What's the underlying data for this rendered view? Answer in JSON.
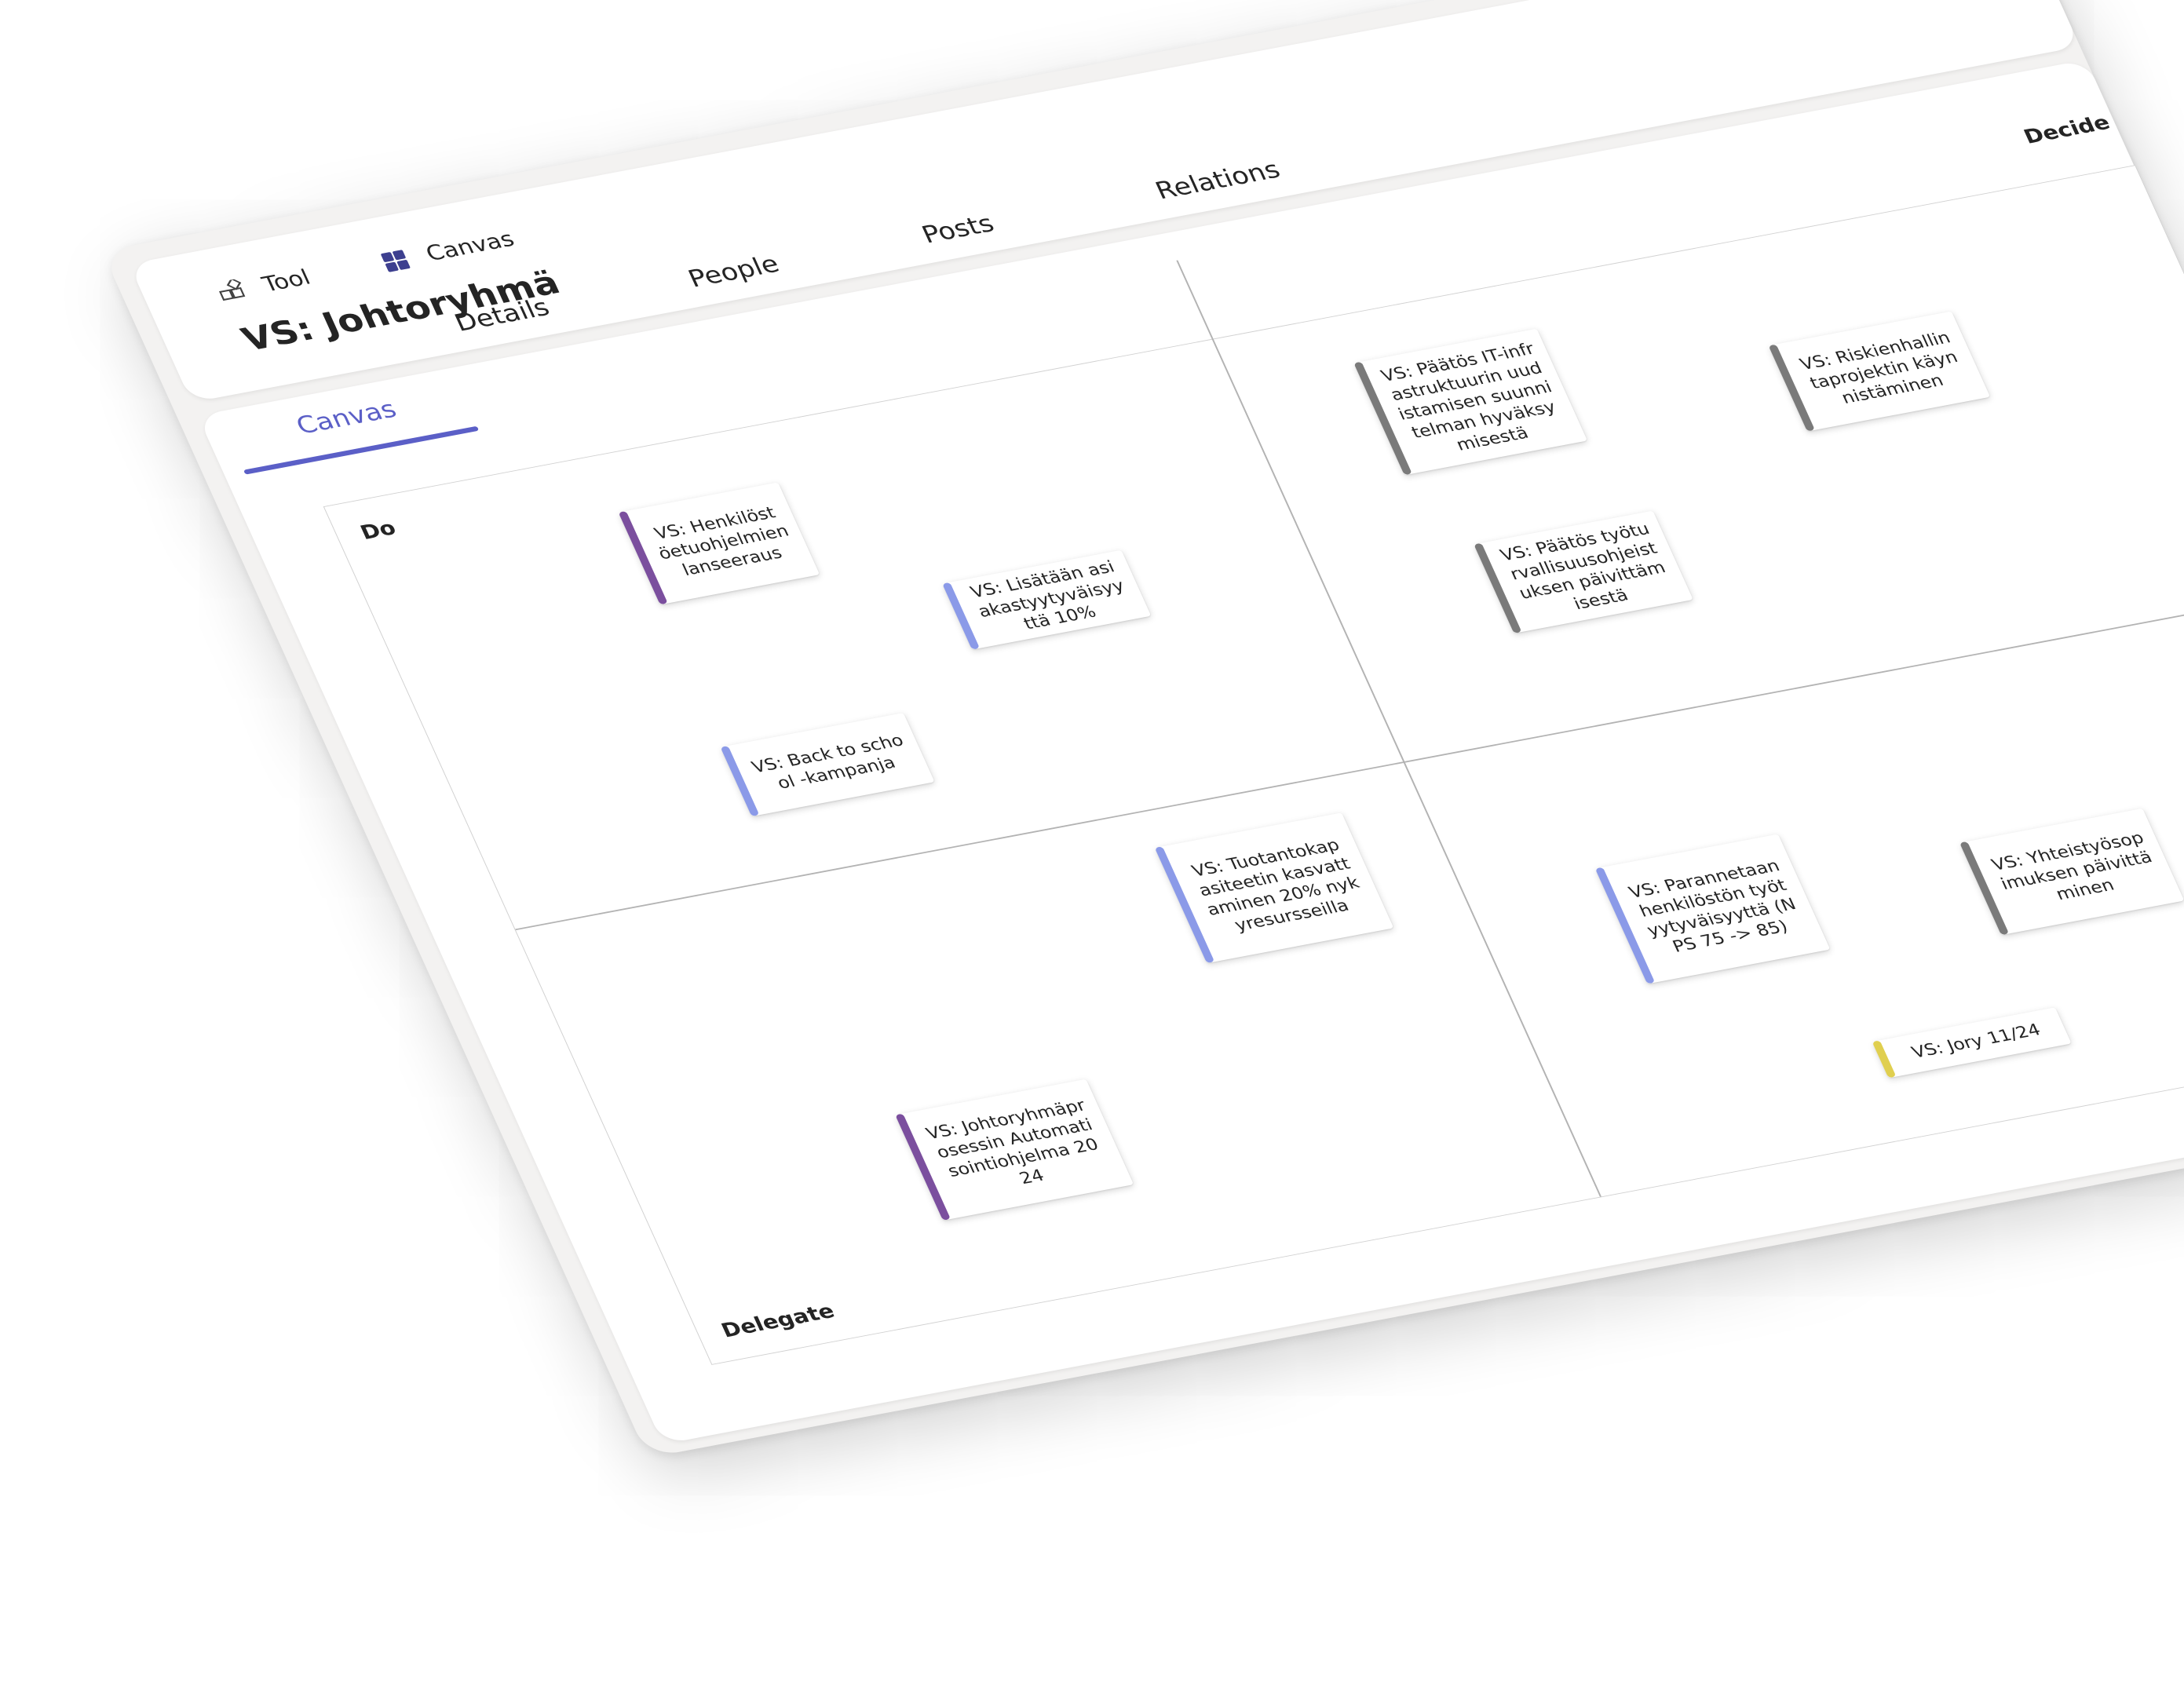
{
  "breadcrumb": {
    "tool_label": "Tool",
    "canvas_label": "Canvas"
  },
  "page": {
    "title": "VS: Johtoryhmä"
  },
  "tabs": [
    {
      "label": "Canvas",
      "active": true
    },
    {
      "label": "Details",
      "active": false
    },
    {
      "label": "People",
      "active": false
    },
    {
      "label": "Posts",
      "active": false
    },
    {
      "label": "Relations",
      "active": false
    }
  ],
  "colors": {
    "accent": "#5b5fc7",
    "purple": "#7b4f9e",
    "periwinkle": "#8b9ae8",
    "gray": "#7a7a7a",
    "yellow": "#e0cf4f",
    "canvas_icon": "#3d3f8f"
  },
  "quadrants": {
    "do": "Do",
    "decide": "Decide",
    "delegate": "Delegate"
  },
  "cards": [
    {
      "text": "VS: Henkilöstöetuohjelmien lanseeraus",
      "color": "#7b4f9e"
    },
    {
      "text": "VS: Lisätään asiakastyytyväisyyttä 10%",
      "color": "#8b9ae8"
    },
    {
      "text": "VS: Back to school -kampanja",
      "color": "#8b9ae8"
    },
    {
      "text": "VS: Päätös IT-infrastruktuurin uudistamisen suunnitelman hyväksymisestä",
      "color": "#7a7a7a"
    },
    {
      "text": "VS: Riskienhallintaprojektin käynnistäminen",
      "color": "#7a7a7a"
    },
    {
      "text": "VS: Päätös työturvallisuusohjeistuksen päivittämisestä",
      "color": "#7a7a7a"
    },
    {
      "text": "VS: Tuotantokapasiteetin kasvattaminen 20% nykyresursseilla",
      "color": "#8b9ae8"
    },
    {
      "text": "VS: Johtoryhmäprosessin Automatisointiohjelma 2024",
      "color": "#7b4f9e"
    },
    {
      "text": "VS: Parannetaan henkilöstön työtyytyväisyyttä (NPS 75 -> 85)",
      "color": "#8b9ae8"
    },
    {
      "text": "VS: Yhteistyösopimuksen päivittäminen",
      "color": "#7a7a7a"
    },
    {
      "text": "VS: Jory 11/24",
      "color": "#e0cf4f"
    }
  ]
}
